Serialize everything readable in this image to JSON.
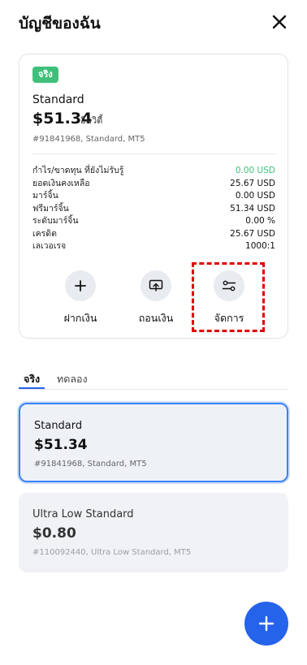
{
  "header": {
    "title": "บัญชีของฉัน",
    "close_icon": "close-icon"
  },
  "account_card": {
    "badge": "จริง",
    "name": "Standard",
    "balance": "$51.34",
    "balance_note": "อีควิตี้",
    "subtitle": "#91841968, Standard, MT5",
    "stats": [
      {
        "label": "กำไร/ขาดทุน ที่ยังไม่รับรู้",
        "value": "0.00 USD",
        "color": "#3fc07a"
      },
      {
        "label": "ยอดเงินคงเหลือ",
        "value": "25.67 USD"
      },
      {
        "label": "มาร์จิ้น",
        "value": "0.00 USD"
      },
      {
        "label": "ฟรีมาร์จิ้น",
        "value": "51.34 USD"
      },
      {
        "label": "ระดับมาร์จิ้น",
        "value": "0.00 %"
      },
      {
        "label": "เครดิต",
        "value": "25.67 USD"
      },
      {
        "label": "เลเวอเรจ",
        "value": "1000:1"
      }
    ],
    "actions": [
      {
        "label": "ฝากเงิน",
        "icon": "plus-icon"
      },
      {
        "label": "ถอนเงิน",
        "icon": "withdraw-icon"
      },
      {
        "label": "จัดการ",
        "icon": "settings-sliders-icon"
      }
    ]
  },
  "tabs": [
    {
      "label": "จริง",
      "active": true
    },
    {
      "label": "ทดลอง",
      "active": false
    }
  ],
  "accounts": [
    {
      "name": "Standard",
      "balance": "$51.34",
      "subtitle": "#91841968, Standard, MT5",
      "selected": true
    },
    {
      "name": "Ultra Low Standard",
      "balance": "$0.80",
      "subtitle": "#110092440, Ultra Low Standard, MT5",
      "selected": false
    }
  ],
  "fab": {
    "icon": "plus-icon"
  },
  "colors": {
    "accent": "#2563eb",
    "positive": "#3fc07a",
    "highlight": "#e00000"
  }
}
